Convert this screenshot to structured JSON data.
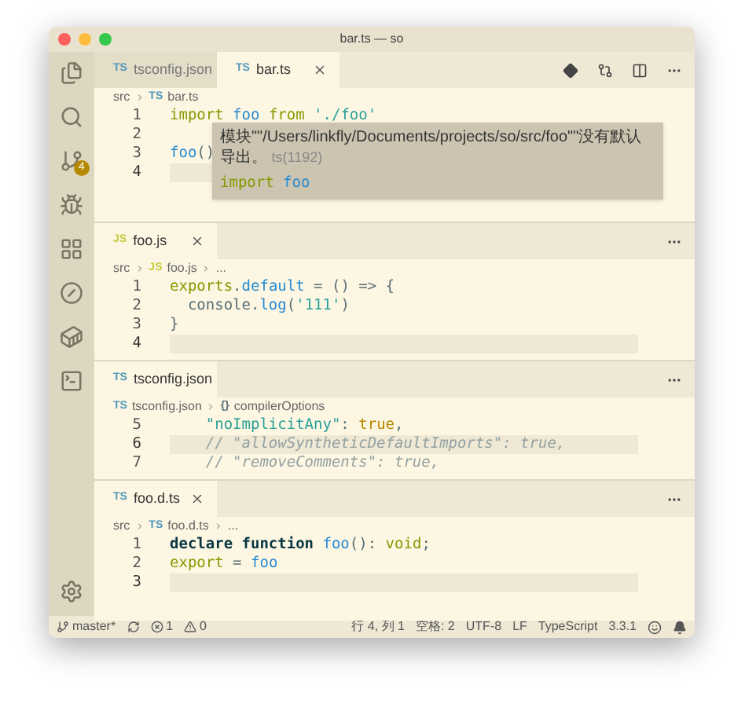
{
  "window": {
    "title": "bar.ts — so"
  },
  "activity_bar": {
    "source_control_badge": "4"
  },
  "editors": [
    {
      "tabs": [
        {
          "badge": "TS",
          "label": "tsconfig.json",
          "selected": false
        },
        {
          "badge": "TS",
          "label": "bar.ts",
          "selected": true
        }
      ],
      "breadcrumb": [
        {
          "label": "src"
        },
        {
          "badge": "TS",
          "label": "bar.ts"
        }
      ],
      "lines": [
        {
          "number": "1",
          "current": false,
          "tokens": [
            {
              "kind": "keyword",
              "text": "import "
            },
            {
              "kind": "ident",
              "text": "foo"
            },
            {
              "kind": "keyword",
              "text": " from "
            },
            {
              "kind": "string",
              "text": "'./foo'"
            }
          ]
        },
        {
          "number": "2",
          "current": false
        },
        {
          "number": "3",
          "current": false,
          "tokens": [
            {
              "kind": "ident",
              "text": "foo"
            },
            {
              "kind": "plain",
              "text": "()"
            }
          ]
        },
        {
          "number": "4",
          "current": true
        }
      ],
      "hover": {
        "message": "模块\"\"/Users/linkfly/Documents/projects/so/src/foo\"\"没有默认导出。",
        "code": "ts(1192)",
        "snippet": [
          {
            "kind": "keyword",
            "text": "import "
          },
          {
            "kind": "ident",
            "text": "foo"
          }
        ]
      }
    },
    {
      "tabs": [
        {
          "badge": "JS",
          "label": "foo.js",
          "selected": true
        }
      ],
      "breadcrumb": [
        {
          "label": "src"
        },
        {
          "badge": "JS",
          "label": "foo.js"
        },
        {
          "label": "..."
        }
      ],
      "lines": [
        {
          "number": "1",
          "current": false,
          "tokens": [
            {
              "kind": "keyword",
              "text": "exports"
            },
            {
              "kind": "plain",
              "text": "."
            },
            {
              "kind": "ident",
              "text": "default"
            },
            {
              "kind": "plain",
              "text": " = () => {"
            }
          ]
        },
        {
          "number": "2",
          "current": false,
          "tokens": [
            {
              "kind": "plain",
              "text": "  console."
            },
            {
              "kind": "ident",
              "text": "log"
            },
            {
              "kind": "plain",
              "text": "("
            },
            {
              "kind": "string",
              "text": "'111'"
            },
            {
              "kind": "plain",
              "text": ")"
            }
          ]
        },
        {
          "number": "3",
          "current": false,
          "tokens": [
            {
              "kind": "plain",
              "text": "}"
            }
          ]
        },
        {
          "number": "4",
          "current": true
        }
      ]
    },
    {
      "tabs": [
        {
          "badge": "TS",
          "label": "tsconfig.json",
          "selected": true
        }
      ],
      "breadcrumb": [
        {
          "badge": "TS",
          "label": "tsconfig.json"
        },
        {
          "badge": "{}",
          "label": "compilerOptions"
        }
      ],
      "lines": [
        {
          "number": "5",
          "current": false,
          "tokens": [
            {
              "kind": "string",
              "text": "    \"noImplicitAny\""
            },
            {
              "kind": "plain",
              "text": ": "
            },
            {
              "kind": "constant",
              "text": "true"
            },
            {
              "kind": "plain",
              "text": ","
            }
          ]
        },
        {
          "number": "6",
          "current": true,
          "tokens": [
            {
              "kind": "comment",
              "text": "    // \"allowSyntheticDefaultImports\": true,"
            }
          ]
        },
        {
          "number": "7",
          "current": false,
          "tokens": [
            {
              "kind": "comment",
              "text": "    // \"removeComments\": true,"
            }
          ]
        }
      ]
    },
    {
      "tabs": [
        {
          "badge": "TS",
          "label": "foo.d.ts",
          "selected": true
        }
      ],
      "breadcrumb": [
        {
          "label": "src"
        },
        {
          "badge": "TS",
          "label": "foo.d.ts"
        },
        {
          "label": "..."
        }
      ],
      "lines": [
        {
          "number": "1",
          "current": false,
          "tokens": [
            {
              "kind": "bold",
              "text": "declare function "
            },
            {
              "kind": "ident",
              "text": "foo"
            },
            {
              "kind": "plain",
              "text": "(): "
            },
            {
              "kind": "keyword",
              "text": "void"
            },
            {
              "kind": "plain",
              "text": ";"
            }
          ]
        },
        {
          "number": "2",
          "current": false,
          "tokens": [
            {
              "kind": "keyword",
              "text": "export"
            },
            {
              "kind": "plain",
              "text": " = "
            },
            {
              "kind": "ident",
              "text": "foo"
            }
          ]
        },
        {
          "number": "3",
          "current": true
        }
      ]
    }
  ],
  "status_bar": {
    "branch": "master*",
    "errors": "1",
    "warnings": "0",
    "items": [
      "行 4, 列 1",
      "空格: 2",
      "UTF-8",
      "LF",
      "TypeScript",
      "3.3.1"
    ]
  }
}
